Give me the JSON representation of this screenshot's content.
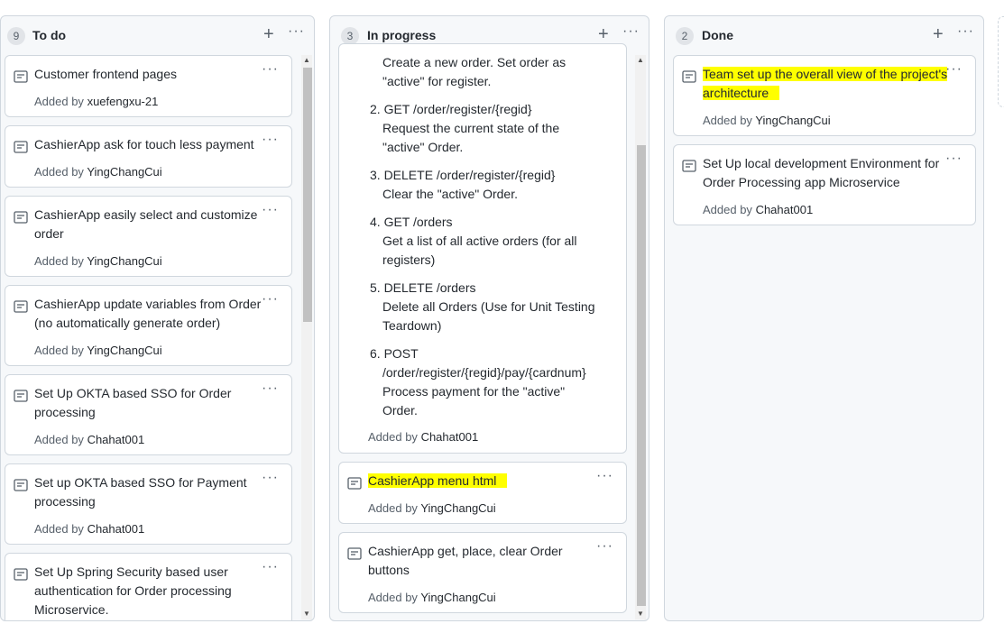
{
  "columns": {
    "todo": {
      "count": "9",
      "title": "To do",
      "cards": [
        {
          "title": "Customer frontend pages",
          "added_prefix": "Added by",
          "user": "xuefengxu-21"
        },
        {
          "title": "CashierApp ask for touch less payment",
          "added_prefix": "Added by",
          "user": "YingChangCui"
        },
        {
          "title_lines": [
            "CashierApp easily select and customize",
            "order"
          ],
          "added_prefix": "Added by",
          "user": "YingChangCui"
        },
        {
          "title_lines": [
            "CashierApp update variables from Order",
            "(no automatically generate order)"
          ],
          "added_prefix": "Added by",
          "user": "YingChangCui"
        },
        {
          "title_lines": [
            "Set Up OKTA based SSO for Order",
            "processing"
          ],
          "added_prefix": "Added by",
          "user": "Chahat001"
        },
        {
          "title_lines": [
            "Set up OKTA based SSO for Payment",
            "processing"
          ],
          "added_prefix": "Added by",
          "user": "Chahat001"
        },
        {
          "title_lines": [
            "Set Up Spring Security based user",
            "authentication for Order processing",
            "Microservice."
          ]
        }
      ]
    },
    "progress": {
      "count": "3",
      "title": "In progress",
      "card1_lines": [
        "Create a new order. Set order as",
        "\"active\" for register.",
        "2. GET /order/register/{regid}",
        "Request the current state of the",
        "\"active\" Order.",
        "3. DELETE /order/register/{regid}",
        "Clear the \"active\" Order.",
        "4. GET /orders",
        "Get a list of all active orders (for all",
        "registers)",
        "5. DELETE /orders",
        "Delete all Orders (Use for Unit Testing",
        "Teardown)",
        "6. POST",
        "/order/register/{regid}/pay/{cardnum}",
        "Process payment for the \"active\"",
        "Order."
      ],
      "card1_added_prefix": "Added by",
      "card1_user": "Chahat001",
      "card2": {
        "title": "CashierApp menu html",
        "added_prefix": "Added by",
        "user": "YingChangCui"
      },
      "card3": {
        "title_lines": [
          "CashierApp get, place, clear Order",
          "buttons"
        ],
        "added_prefix": "Added by",
        "user": "YingChangCui"
      }
    },
    "done": {
      "count": "2",
      "title": "Done",
      "card1": {
        "title_lines": [
          "Team set up the overall view of the project's",
          "architecture"
        ],
        "added_prefix": "Added by",
        "user": "YingChangCui"
      },
      "card2": {
        "title_lines": [
          "Set Up local development Environment for",
          "Order Processing app Microservice"
        ],
        "added_prefix": "Added by",
        "user": "Chahat001"
      }
    }
  },
  "icons": {
    "add": "plus-icon",
    "menu": "kebab-icon",
    "note": "note-icon"
  },
  "colors": {
    "highlight": "#ffff00",
    "column_bg": "#f6f8fa",
    "border": "#d0d7de"
  }
}
